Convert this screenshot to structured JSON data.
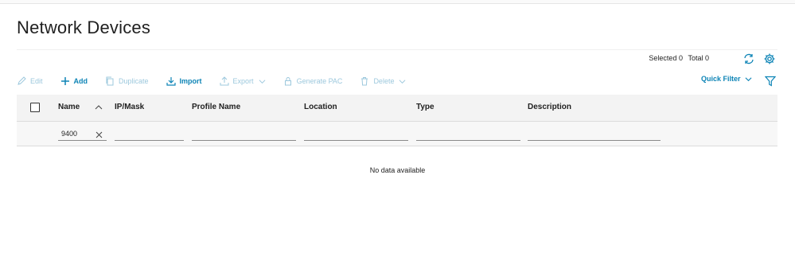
{
  "page": {
    "title": "Network Devices"
  },
  "counts": {
    "selected_label": "Selected 0",
    "total_label": "Total 0"
  },
  "toolbar": {
    "edit": "Edit",
    "add": "Add",
    "duplicate": "Duplicate",
    "import": "Import",
    "export": "Export",
    "generate_pac": "Generate PAC",
    "delete": "Delete",
    "quick_filter": "Quick Filter"
  },
  "table": {
    "columns": [
      "Name",
      "IP/Mask",
      "Profile Name",
      "Location",
      "Type",
      "Description"
    ],
    "filters": {
      "name": "9400",
      "ip_mask": "",
      "profile_name": "",
      "location": "",
      "type": "",
      "description": ""
    },
    "empty_text": "No data available"
  },
  "icons": {
    "edit": "pencil-icon",
    "add": "plus-icon",
    "duplicate": "duplicate-icon",
    "import": "import-icon",
    "export": "export-icon",
    "generate_pac": "lock-icon",
    "delete": "trash-icon",
    "refresh": "refresh-icon",
    "settings": "gear-icon",
    "filter": "funnel-icon",
    "sort": "chevron-up-icon",
    "clear": "close-icon"
  },
  "colors": {
    "accent": "#0d84b6",
    "disabled": "#9cc8dd",
    "header_bg": "#f3f3f3"
  }
}
